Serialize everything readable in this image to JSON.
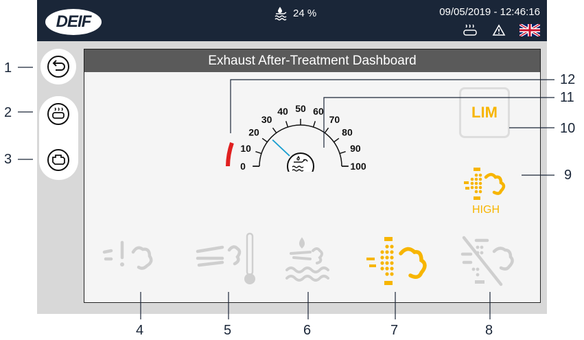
{
  "header": {
    "logo": "DEIF",
    "fluid_level": "24 %",
    "datetime": "09/05/2019 - 12:46:16"
  },
  "panel": {
    "title": "Exhaust After-Treatment Dashboard",
    "limit_label": "LIM",
    "status_label": "HIGH"
  },
  "gauge": {
    "ticks": [
      "0",
      "10",
      "20",
      "30",
      "40",
      "50",
      "60",
      "70",
      "80",
      "90",
      "100"
    ],
    "value": 24
  },
  "callouts": [
    "1",
    "2",
    "3",
    "4",
    "5",
    "6",
    "7",
    "8",
    "9",
    "10",
    "11",
    "12"
  ],
  "colors": {
    "header_bg": "#1a2638",
    "accent": "#f7b500",
    "red": "#e02020",
    "inactive": "#cfcfcf"
  }
}
